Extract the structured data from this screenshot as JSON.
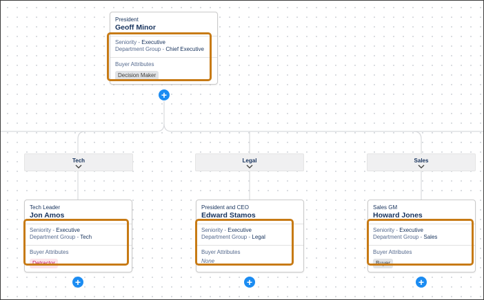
{
  "top_card": {
    "title": "President",
    "name": "Geoff Minor",
    "seniority_label": "Seniority - ",
    "seniority_value": "Executive",
    "dept_label": "Department Group - ",
    "dept_value": "Chief Executive",
    "buyer_attributes_label": "Buyer Attributes",
    "tag": "Decision Maker"
  },
  "departments": [
    {
      "label": "Tech"
    },
    {
      "label": "Legal"
    },
    {
      "label": "Sales"
    }
  ],
  "cards": [
    {
      "title": "Tech Leader",
      "name": "Jon Amos",
      "seniority_label": "Seniority - ",
      "seniority_value": "Executive",
      "dept_label": "Department Group - ",
      "dept_value": "Tech",
      "buyer_attributes_label": "Buyer Attributes",
      "tag": "Detractor"
    },
    {
      "title": "President and CEO",
      "name": "Edward Stamos",
      "seniority_label": "Seniority - ",
      "seniority_value": "Executive",
      "dept_label": "Department Group - ",
      "dept_value": "Legal",
      "buyer_attributes_label": "Buyer Attributes",
      "none": "None"
    },
    {
      "title": "Sales GM",
      "name": "Howard Jones",
      "seniority_label": "Seniority - ",
      "seniority_value": "Executive",
      "dept_label": "Department Group - ",
      "dept_value": "Sales",
      "buyer_attributes_label": "Buyer Attributes",
      "tag": "Buyer"
    }
  ],
  "add_button_glyph": "+",
  "colors": {
    "highlight": "#c77a14",
    "add_button": "#1b8cf2",
    "detractor_bg": "#fbe3ea",
    "detractor_text": "#c2185b",
    "text_dark": "#16325c"
  }
}
